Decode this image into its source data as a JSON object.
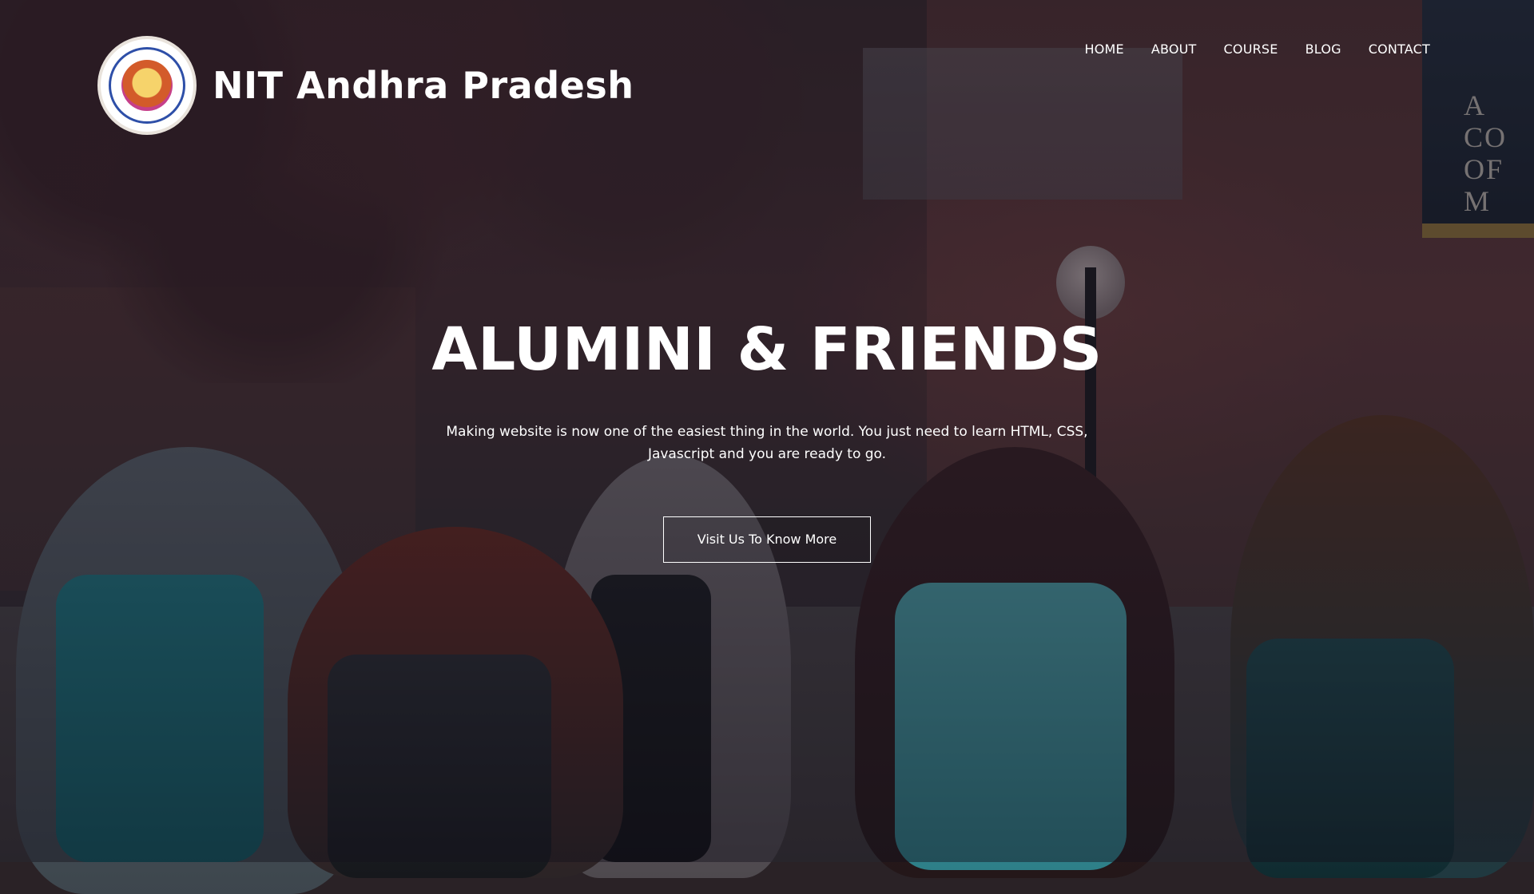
{
  "brand": {
    "title": "NIT Andhra Pradesh",
    "logo_icon": "nit-andhra-pradesh-emblem"
  },
  "nav": {
    "items": [
      "HOME",
      "ABOUT",
      "COURSE",
      "BLOG",
      "CONTACT"
    ]
  },
  "hero": {
    "title": "ALUMINI & FRIENDS",
    "text": "Making website is now one of the easiest thing in the world. You just need to learn HTML, CSS, Javascript and you are ready to go.",
    "button_label": "Visit Us To Know More"
  },
  "background": {
    "banner_text": "A CO OF M"
  },
  "colors": {
    "text": "#ffffff",
    "overlay": "rgba(20,18,28,0.45)"
  }
}
